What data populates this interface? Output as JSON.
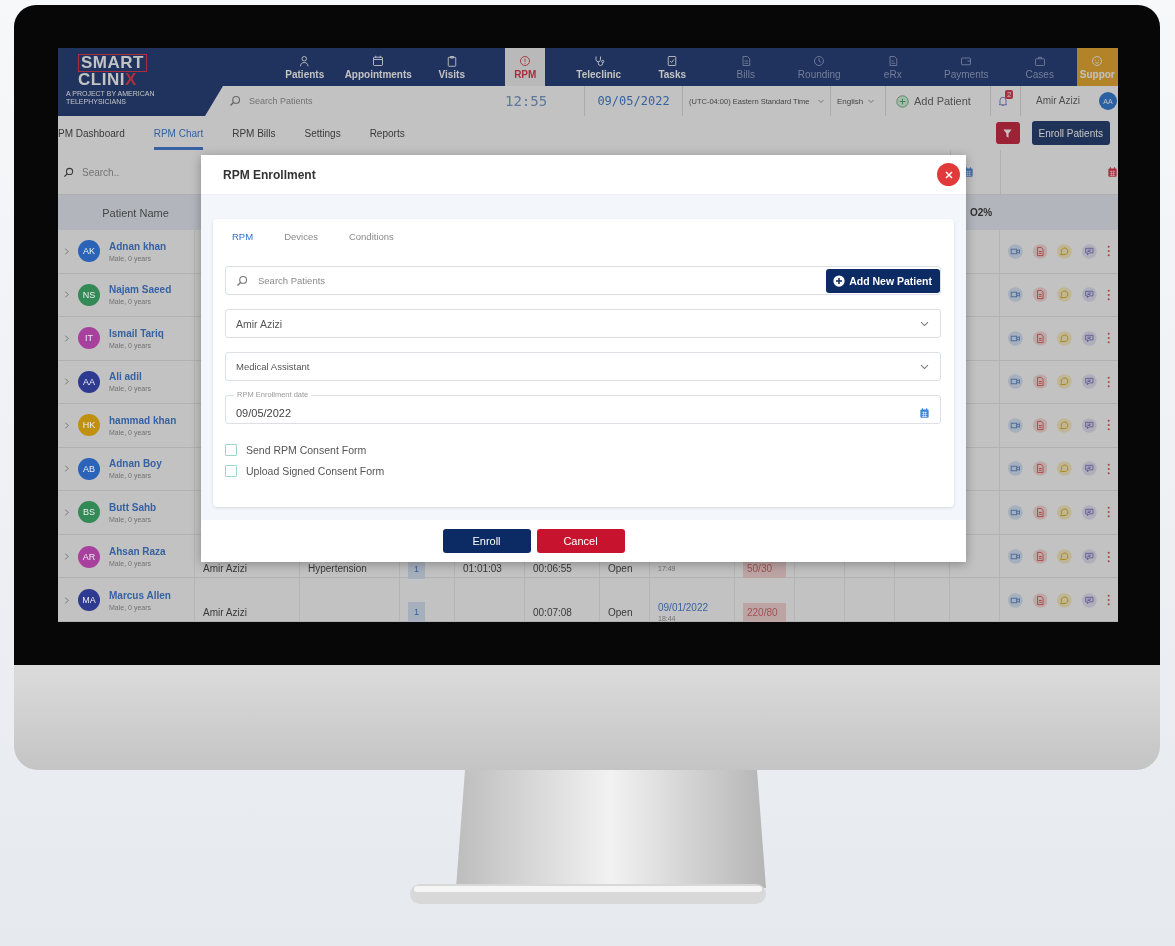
{
  "logo": {
    "line1": "SMART",
    "line2": "CLINI",
    "line2_accent": "X",
    "tagline": "A PROJECT BY AMERICAN TELEPHYSICIANS"
  },
  "nav": [
    {
      "label": "Patients",
      "kind": "module",
      "selected": false,
      "disabled": false
    },
    {
      "label": "Appointments",
      "kind": "module",
      "selected": false,
      "disabled": false
    },
    {
      "label": "Visits",
      "kind": "module",
      "selected": false,
      "disabled": false
    },
    {
      "label": "RPM",
      "kind": "module",
      "selected": true,
      "disabled": false
    },
    {
      "label": "Teleclinic",
      "kind": "module",
      "selected": false,
      "disabled": false
    },
    {
      "label": "Tasks",
      "kind": "module",
      "selected": false,
      "disabled": false
    },
    {
      "label": "Bills",
      "kind": "module",
      "selected": false,
      "disabled": true
    },
    {
      "label": "Rounding",
      "kind": "module",
      "selected": false,
      "disabled": true
    },
    {
      "label": "eRx",
      "kind": "module",
      "selected": false,
      "disabled": true
    },
    {
      "label": "Payments",
      "kind": "module",
      "selected": false,
      "disabled": true
    },
    {
      "label": "Cases",
      "kind": "module",
      "selected": false,
      "disabled": true
    },
    {
      "label": "Suppor",
      "kind": "support",
      "selected": false,
      "disabled": false
    }
  ],
  "topbar": {
    "search": {
      "placeholder": "Search Patients"
    },
    "time": "12:55",
    "date": "09/05/2022",
    "timezone": "(UTC-04:00) Eastern Standard Time",
    "language": "English",
    "add_patient": "Add Patient",
    "notification_count": "2",
    "user": "Amir Azizi",
    "avatar": "AA"
  },
  "subtabs": [
    {
      "label": "PM Dashboard",
      "selected": false
    },
    {
      "label": "RPM Chart",
      "selected": true
    },
    {
      "label": "RPM Bills",
      "selected": false
    },
    {
      "label": "Settings",
      "selected": false
    },
    {
      "label": "Reports",
      "selected": false
    }
  ],
  "enroll_patients": "Enroll Patients",
  "table": {
    "search": {
      "placeholder": "Search.."
    },
    "header": {
      "patient_name": "Patient Name",
      "column_13": "O2%"
    },
    "rows": [
      {
        "initials": "AK",
        "name": "Adnan khan",
        "details": "Male, 0 years",
        "color": "#2a63b8"
      },
      {
        "initials": "NS",
        "name": "Najam Saeed",
        "details": "Male, 0 years",
        "color": "#338a57"
      },
      {
        "initials": "IT",
        "name": "Ismail Tariq",
        "details": "Male, 0 years",
        "color": "#a8419e"
      },
      {
        "initials": "AA",
        "name": "Ali adil",
        "details": "Male, 0 years",
        "color": "#2e3a8f"
      },
      {
        "initials": "HK",
        "name": "hammad khan",
        "details": "Male, 0 years",
        "color": "#c0900f"
      },
      {
        "initials": "AB",
        "name": "Adnan Boy",
        "details": "Male, 0 years",
        "color": "#2a63b8"
      },
      {
        "initials": "BS",
        "name": "Butt Sahb",
        "details": "Male, 0 years",
        "color": "#338a57"
      },
      {
        "initials": "AR",
        "name": "Ahsan Raza",
        "details": "Male, 0 years",
        "color": "#a8419e",
        "cells": {
          "provider": "Amir Azizi",
          "condition": "Hypertension",
          "count": "1",
          "duration_1": "01:01:03",
          "duration_2": "00:06:55",
          "status": "Open",
          "time": "17:49",
          "reading": "50/30"
        }
      },
      {
        "initials": "MA",
        "name": "Marcus Allen",
        "details": "Male, 0 years",
        "color": "#2e3a8f",
        "cells": {
          "provider": "Amir Azizi",
          "count": "1",
          "duration_2": "00:07:08",
          "status": "Open",
          "date": "09/01/2022",
          "time": "18:44",
          "reading": "220/80"
        }
      }
    ]
  },
  "modal": {
    "title": "RPM Enrollment",
    "tabs": [
      {
        "label": "RPM",
        "selected": true
      },
      {
        "label": "Devices",
        "selected": false
      },
      {
        "label": "Conditions",
        "selected": false
      }
    ],
    "search": {
      "placeholder": "Search Patients"
    },
    "add_new_patient": "Add New Patient",
    "selects": [
      {
        "value": "Amir Azizi"
      },
      {
        "value": "Medical Assistant"
      }
    ],
    "date_field": {
      "label": "RPM Enrollment date",
      "value": "09/05/2022"
    },
    "checkboxes": [
      {
        "label": "Send RPM Consent Form",
        "checked": false
      },
      {
        "label": "Upload Signed Consent Form",
        "checked": false
      }
    ],
    "buttons": [
      {
        "label": "Enroll",
        "kind": "primary"
      },
      {
        "label": "Cancel",
        "kind": "danger"
      }
    ]
  }
}
